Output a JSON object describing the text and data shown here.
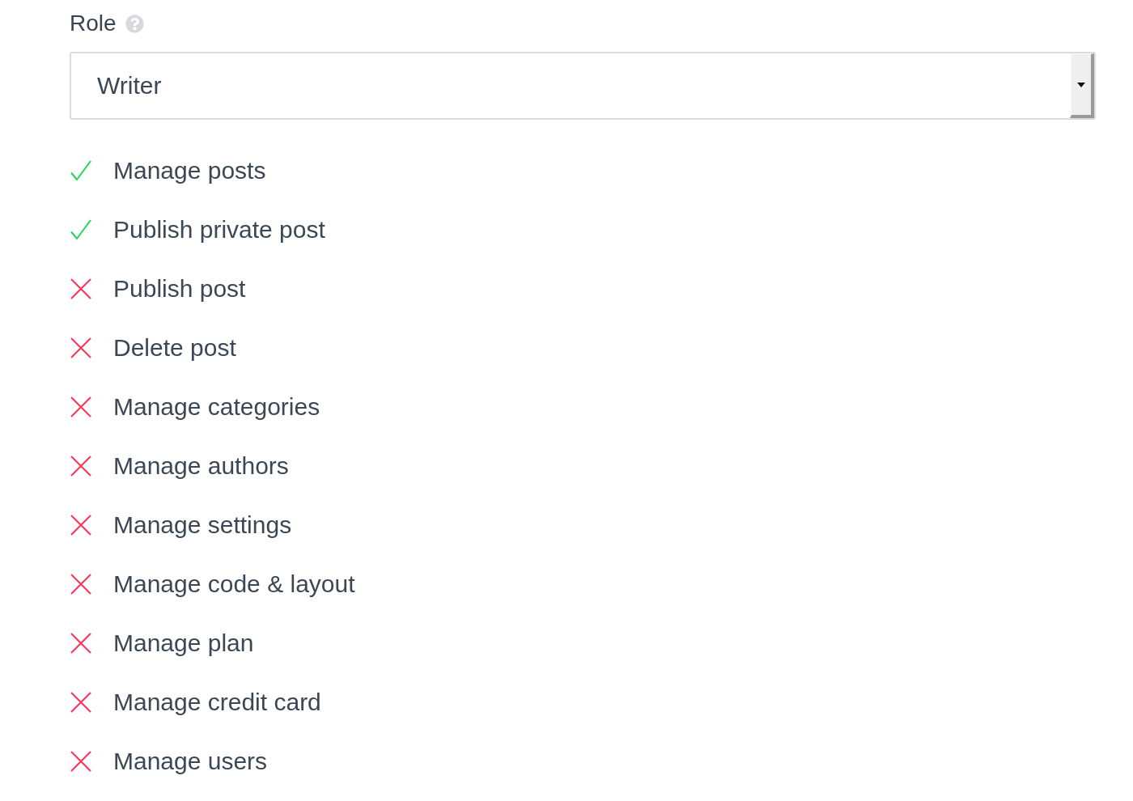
{
  "role": {
    "label": "Role",
    "value": "Writer"
  },
  "permissions": [
    {
      "label": "Manage posts",
      "allowed": true
    },
    {
      "label": "Publish private post",
      "allowed": true
    },
    {
      "label": "Publish post",
      "allowed": false
    },
    {
      "label": "Delete post",
      "allowed": false
    },
    {
      "label": "Manage categories",
      "allowed": false
    },
    {
      "label": "Manage authors",
      "allowed": false
    },
    {
      "label": "Manage settings",
      "allowed": false
    },
    {
      "label": "Manage code & layout",
      "allowed": false
    },
    {
      "label": "Manage plan",
      "allowed": false
    },
    {
      "label": "Manage credit card",
      "allowed": false
    },
    {
      "label": "Manage users",
      "allowed": false
    }
  ]
}
